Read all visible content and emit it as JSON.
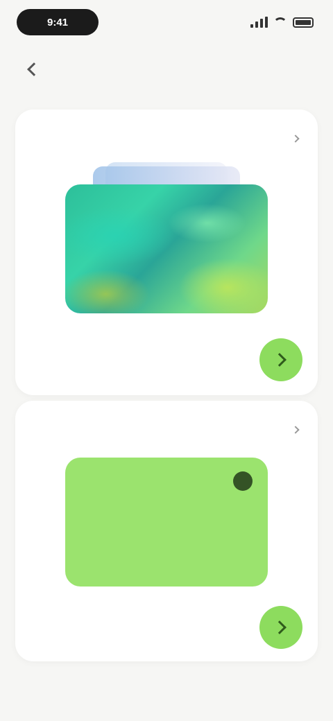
{
  "status_bar": {
    "time": "9:41"
  },
  "header": {
    "title": ""
  },
  "sections": [
    {
      "title": "",
      "link_label": "",
      "card_label": "",
      "description": ""
    },
    {
      "title": "",
      "link_label": "",
      "card_label": "",
      "description": ""
    }
  ],
  "colors": {
    "background": "#f6f6f4",
    "accent_green": "#8ddc5e",
    "card_lime": "#9be36e",
    "card_gradient": [
      "#2dbf9a",
      "#37d3a8",
      "#6fd88a",
      "#a9d95f"
    ]
  },
  "icons": [
    "back-chevron-icon",
    "signal-icon",
    "wifi-icon",
    "battery-icon",
    "chevron-right-icon",
    "arrow-right-icon"
  ]
}
